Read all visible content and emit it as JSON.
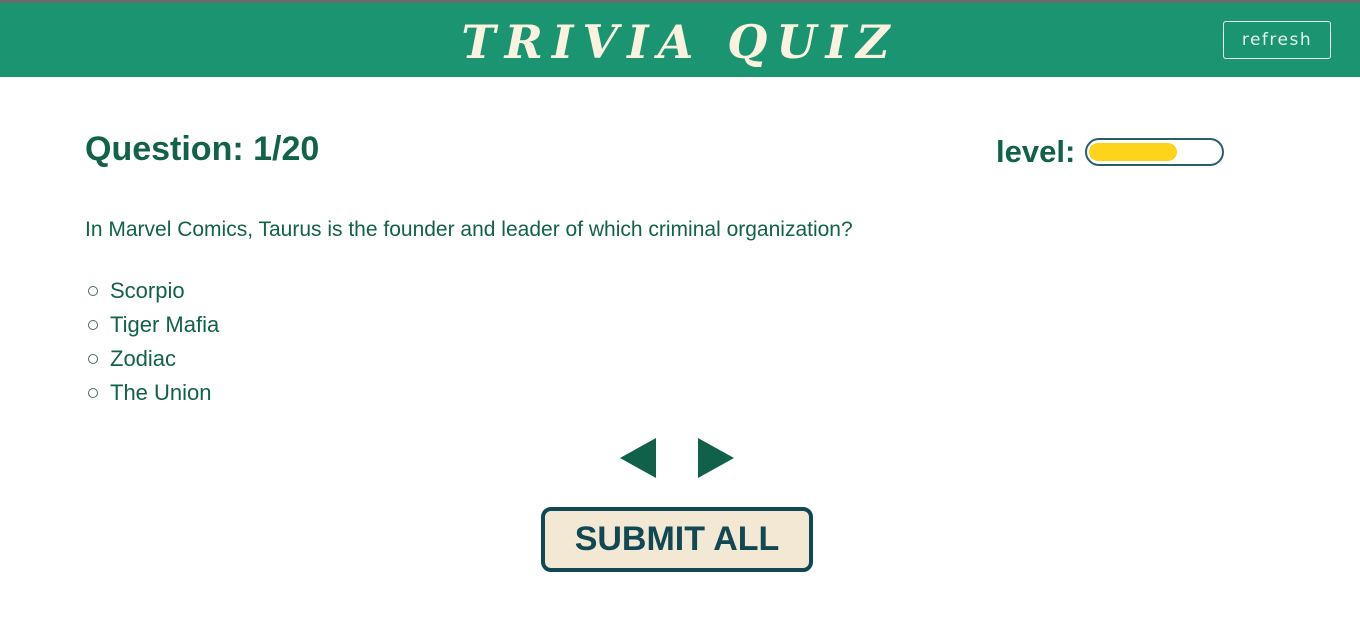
{
  "header": {
    "title": "TRIVIA QUIZ",
    "refresh_label": "refresh",
    "background": "#1b9571"
  },
  "quiz": {
    "counter_text": "Question: 1/20",
    "level_label": "level:",
    "level_fraction": 0.67,
    "level_color": "#fdd31b",
    "question": "In Marvel Comics, Taurus is the founder and leader of which criminal organization?",
    "options": [
      {
        "label": "Scorpio",
        "selected": false
      },
      {
        "label": "Tiger Mafia",
        "selected": false
      },
      {
        "label": "Zodiac",
        "selected": false
      },
      {
        "label": "The Union",
        "selected": false
      }
    ]
  },
  "navigation": {
    "prev_icon": "triangle-left-icon",
    "next_icon": "triangle-right-icon"
  },
  "submit_label": "SUBMIT ALL"
}
